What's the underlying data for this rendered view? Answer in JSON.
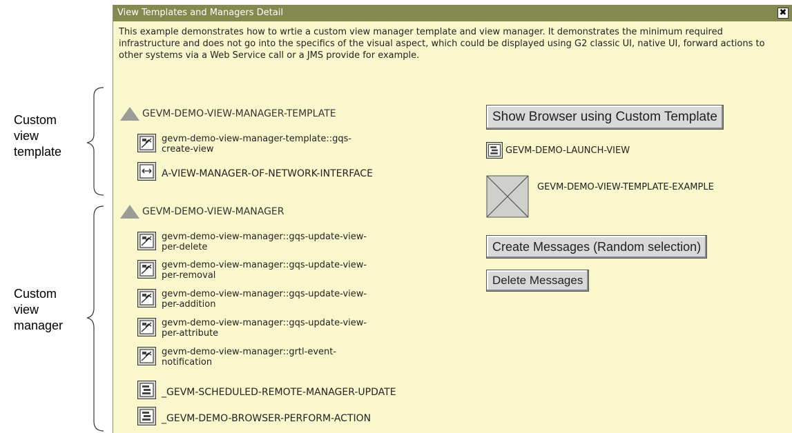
{
  "annotations": {
    "template": "Custom\nview\ntemplate",
    "manager": "Custom\nview\nmanager"
  },
  "window": {
    "title": "View Templates and Managers Detail",
    "close_label": "✖",
    "intro": "This example demonstrates how to wrtie a custom view manager template and view manager. It demonstrates the minimum required infrastructure and does not go into the specifics of the visual aspect, which could be displayed using G2 classic UI, native UI, forward actions to other systems via a Web Service call or a JMS provide for example."
  },
  "template_section": {
    "header": "GEVM-DEMO-VIEW-MANAGER-TEMPLATE",
    "items": [
      {
        "label": "gevm-demo-view-manager-template::gqs-\n  create-view",
        "icon": "method-icon"
      },
      {
        "label": "A-VIEW-MANAGER-OF-NETWORK-INTERFACE",
        "icon": "interface-icon"
      }
    ]
  },
  "manager_section": {
    "header": "GEVM-DEMO-VIEW-MANAGER",
    "items": [
      {
        "label": "gevm-demo-view-manager::gqs-update-view-\n  per-delete",
        "icon": "method-icon"
      },
      {
        "label": "gevm-demo-view-manager::gqs-update-view-\n  per-removal",
        "icon": "method-icon"
      },
      {
        "label": "gevm-demo-view-manager::gqs-update-view-\n  per-addition",
        "icon": "method-icon"
      },
      {
        "label": "gevm-demo-view-manager::gqs-update-view-\n  per-attribute",
        "icon": "method-icon"
      },
      {
        "label": "gevm-demo-view-manager::grtl-event-\n  notification",
        "icon": "method-icon"
      },
      {
        "label": "_GEVM-SCHEDULED-REMOTE-MANAGER-UPDATE",
        "icon": "procedure-icon"
      },
      {
        "label": "_GEVM-DEMO-BROWSER-PERFORM-ACTION",
        "icon": "procedure-icon"
      }
    ]
  },
  "right_panel": {
    "show_browser_button": "Show Browser using Custom Template",
    "launch_view_label": "GEVM-DEMO-LAUNCH-VIEW",
    "template_example_label": "GEVM-DEMO-VIEW-TEMPLATE-EXAMPLE",
    "create_messages_button": "Create Messages (Random selection)",
    "delete_messages_button": "Delete Messages"
  }
}
